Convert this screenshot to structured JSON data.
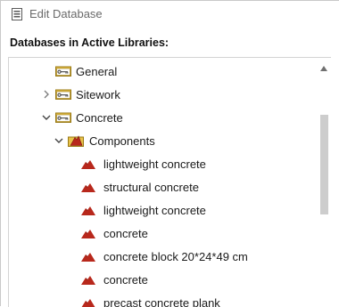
{
  "window": {
    "title": "Edit Database"
  },
  "section": {
    "header": "Databases in Active Libraries:"
  },
  "tree": [
    {
      "label": "General",
      "icon": "key-folder-icon",
      "expander": "none"
    },
    {
      "label": "Sitework",
      "icon": "key-folder-icon",
      "expander": "collapsed"
    },
    {
      "label": "Concrete",
      "icon": "key-folder-icon",
      "expander": "expanded"
    },
    {
      "label": "Components",
      "icon": "component-folder-icon",
      "expander": "expanded"
    },
    {
      "label": "lightweight concrete",
      "icon": "material-icon",
      "expander": "none"
    },
    {
      "label": "structural concrete",
      "icon": "material-icon",
      "expander": "none"
    },
    {
      "label": "lightweight concrete",
      "icon": "material-icon",
      "expander": "none"
    },
    {
      "label": "concrete",
      "icon": "material-icon",
      "expander": "none"
    },
    {
      "label": "concrete block 20*24*49 cm",
      "icon": "material-icon",
      "expander": "none"
    },
    {
      "label": "concrete",
      "icon": "material-icon",
      "expander": "none"
    },
    {
      "label": "precast concrete plank",
      "icon": "material-icon",
      "expander": "none"
    }
  ],
  "colors": {
    "folder": "#e0b428",
    "material": "#b8281c",
    "title_text": "#6a6a6a",
    "scroll_thumb": "#cdcdcd"
  }
}
